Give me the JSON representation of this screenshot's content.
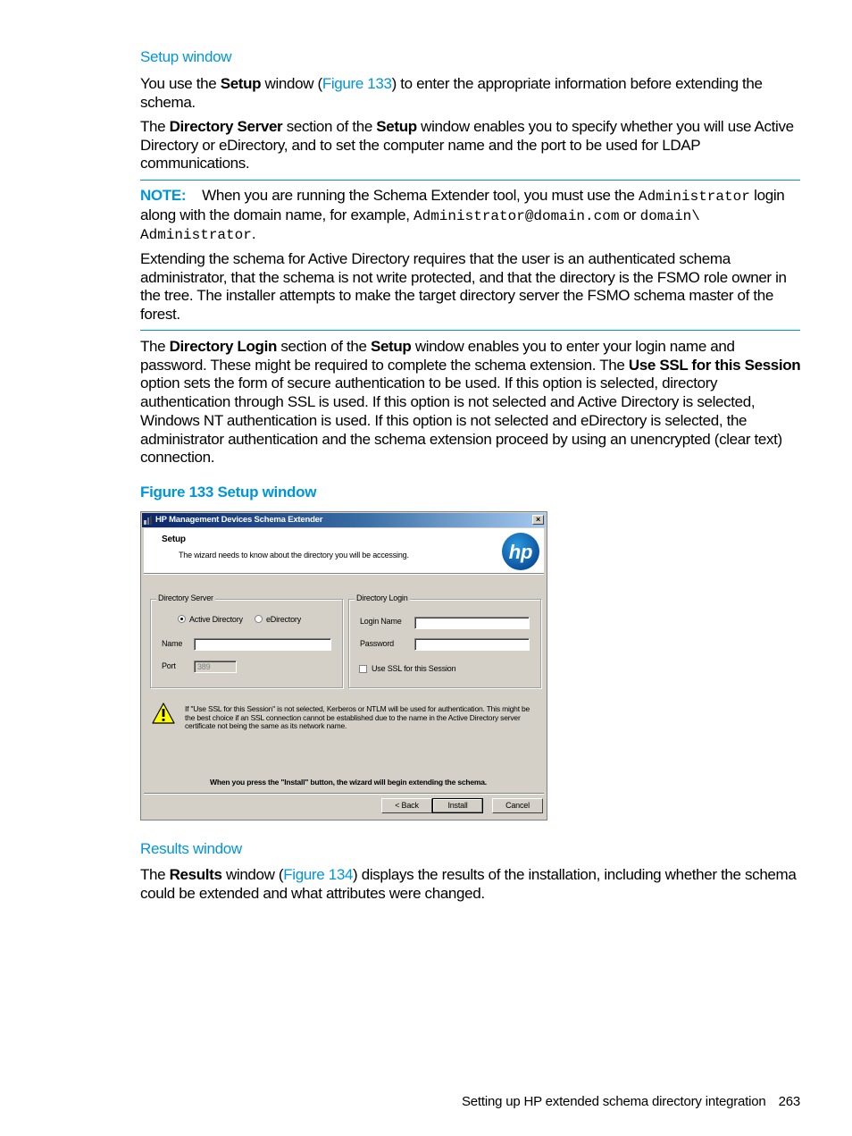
{
  "sections": {
    "setup_heading": "Setup window",
    "p1": {
      "t1": "You use the ",
      "b1": "Setup",
      "t2": " window (",
      "link": "Figure 133",
      "t3": ") to enter the appropriate information before extending the schema."
    },
    "p2": {
      "t1": "The ",
      "b1": "Directory Server",
      "t2": " section of the ",
      "b2": "Setup",
      "t3": " window enables you to specify whether you will use Active Directory or eDirectory, and to set the computer name and the port to be used for LDAP communications."
    },
    "note": {
      "label": "NOTE:",
      "t1": "When you are running the Schema Extender tool, you must use the ",
      "code1": "Administrator",
      "t2": " login along with the domain name, for example, ",
      "code2": "Administrator@domain.com",
      "t3": " or ",
      "code3": "domain\\ Administrator",
      "t4": ".",
      "p2": "Extending the schema for Active Directory requires that the user is an authenticated schema administrator, that the schema is not write protected, and that the directory is the FSMO role owner in the tree. The installer attempts to make the target directory server the FSMO schema master of the forest."
    },
    "p3": {
      "t1": "The ",
      "b1": "Directory Login",
      "t2": " section of the ",
      "b2": "Setup",
      "t3": " window enables you to enter your login name and password. These might be required to complete the schema extension. The ",
      "b3": "Use SSL for this Session",
      "t4": " option sets the form of secure authentication to be used. If this option is selected, directory authentication through SSL is used. If this option is not selected and Active Directory is selected, Windows NT authentication is used. If this option is not selected and eDirectory is selected, the administrator authentication and the schema extension proceed by using an unencrypted (clear text) connection."
    },
    "figure_caption": "Figure 133 Setup window",
    "results_heading": "Results window",
    "p4": {
      "t1": "The ",
      "b1": "Results",
      "t2": " window (",
      "link": "Figure 134",
      "t3": ") displays the results of the installation, including whether the schema could be extended and what attributes were changed."
    }
  },
  "dialog": {
    "title": "HP Management Devices Schema Extender",
    "close_glyph": "×",
    "header_title": "Setup",
    "header_subtitle": "The wizard needs to know about the directory you will be accessing.",
    "logo_text": "hp",
    "directory_server": {
      "legend": "Directory Server",
      "radio_active": "Active Directory",
      "radio_edirectory": "eDirectory",
      "selected": "Active Directory",
      "name_label": "Name",
      "name_value": "",
      "port_label": "Port",
      "port_value": "389"
    },
    "directory_login": {
      "legend": "Directory Login",
      "login_label": "Login Name",
      "login_value": "",
      "password_label": "Password",
      "password_value": "",
      "ssl_label": "Use SSL for this Session",
      "ssl_checked": false
    },
    "warning": "If \"Use SSL for this Session\" is not selected, Kerberos or NTLM will be used for authentication. This might be the best choice if an SSL connection cannot be established due to the name in the Active Directory server certificate not being the same as its network name.",
    "install_message": "When you press the \"Install\" button, the wizard will begin extending the schema.",
    "buttons": {
      "back": "< Back",
      "install": "Install",
      "cancel": "Cancel"
    }
  },
  "footer": {
    "title": "Setting up HP extended schema directory integration",
    "page": "263"
  },
  "colors": {
    "accent": "#0096d6",
    "dialog_bg": "#d4d0c8",
    "titlebar": "#0a246a"
  }
}
